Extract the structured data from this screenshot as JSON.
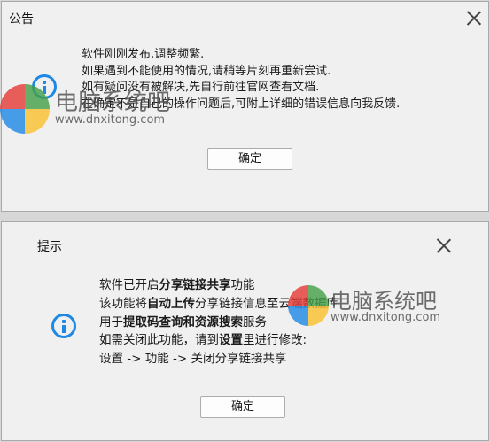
{
  "dialog1": {
    "title": "公告",
    "lines": [
      "软件刚刚发布,调整频繁.",
      "如果遇到不能使用的情况,请稍等片刻再重新尝试.",
      "如有疑问没有被解决,先自行前往官网查看文档.",
      "在确定不是自己的操作问题后,可附上详细的错误信息向我反馈."
    ],
    "ok_label": "确定"
  },
  "dialog2": {
    "title": "提示",
    "line1_a": "软件已开启",
    "line1_b": "分享链接共享",
    "line1_c": "功能",
    "line2_a": "该功能将",
    "line2_b": "自动上传",
    "line2_c": "分享链接信息至云端数据库",
    "line3_a": "用于",
    "line3_b": "提取码查询和资源搜索",
    "line3_c": "服务",
    "line4_a": "如需关闭此功能，请到",
    "line4_b": "设置",
    "line4_c": "里进行修改:",
    "line5": "设置 -> 功能 -> 关闭分享链接共享",
    "ok_label": "确定"
  },
  "watermark": {
    "cn": "电脑系统吧",
    "en": "www.dnxitong.com",
    "logo_colors": [
      "#e53935",
      "#43a047",
      "#1e88e5",
      "#fbc02d"
    ]
  }
}
